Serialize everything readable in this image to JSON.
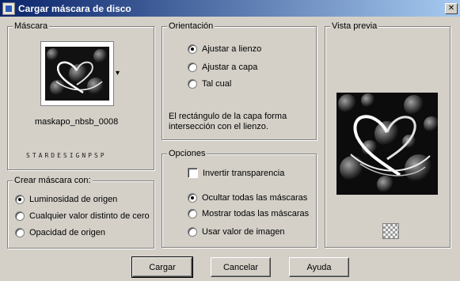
{
  "window": {
    "title": "Cargar máscara de disco",
    "close_glyph": "✕"
  },
  "mascara": {
    "legend": "Máscara",
    "file_name": "maskapo_nbsb_0008",
    "credit_text": "STARDESIGNPSP",
    "dropdown_glyph": "▾"
  },
  "orientacion": {
    "legend": "Orientación",
    "options": [
      "Ajustar a lienzo",
      "Ajustar a capa",
      "Tal cual"
    ],
    "selected": "Ajustar a lienzo",
    "description": "El rectángulo de la capa forma intersección con el lienzo."
  },
  "opciones": {
    "legend": "Opciones",
    "invert_label": "Invertir transparencia",
    "invert_checked": false,
    "options": [
      "Ocultar todas las máscaras",
      "Mostrar todas las máscaras",
      "Usar valor de imagen"
    ],
    "selected": "Ocultar todas las máscaras"
  },
  "crear": {
    "legend": "Crear máscara con:",
    "options": [
      "Luminosidad de origen",
      "Cualquier valor distinto de cero",
      "Opacidad de origen"
    ],
    "selected": "Luminosidad de origen"
  },
  "preview": {
    "legend": "Vista previa"
  },
  "buttons": {
    "load": "Cargar",
    "cancel": "Cancelar",
    "help": "Ayuda"
  }
}
